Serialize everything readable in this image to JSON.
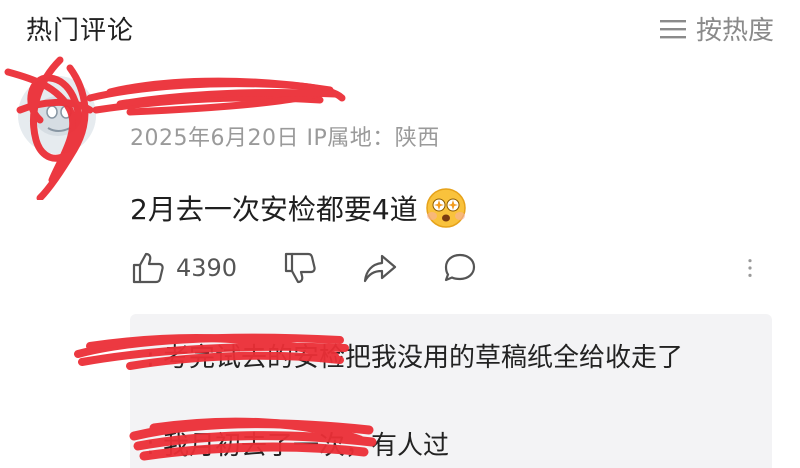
{
  "header": {
    "title": "热门评论",
    "sort_label": "按热度"
  },
  "comment": {
    "author_name": "",
    "meta": "2025年6月20日  IP属地：陕西",
    "text": "2月去一次安检都要4道",
    "emoji": "astonished-face-emoji",
    "likes": "4390"
  },
  "replies": [
    {
      "author": "",
      "text": ": 考完试去的安检把我没用的草稿纸全给收走了"
    },
    {
      "author": "",
      "text": ": 我月初去了一次，有人过"
    }
  ],
  "colors": {
    "scribble": "#ec2f37",
    "reply_bg": "#f3f3f5",
    "meta_text": "#9a9a9a",
    "link_blue": "#4a6b9a"
  }
}
